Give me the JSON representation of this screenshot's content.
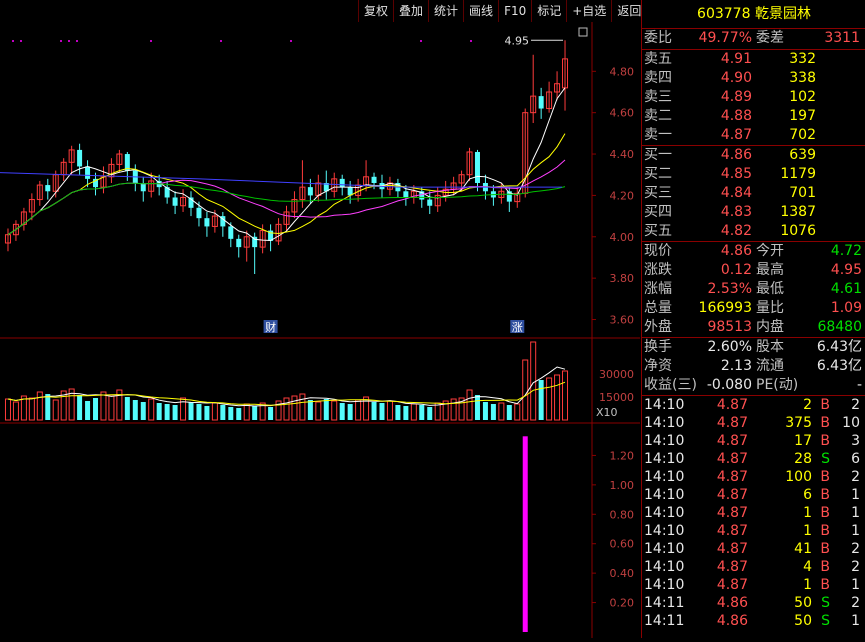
{
  "toolbar": [
    "复权",
    "叠加",
    "统计",
    "画线",
    "F10",
    "标记",
    "+自选",
    "返回"
  ],
  "stock": {
    "code": "603778",
    "name": "乾景园林"
  },
  "order_ratio": {
    "label1": "委比",
    "value1": "49.77%",
    "label2": "委差",
    "value2": "3311"
  },
  "asks": [
    {
      "label": "卖五",
      "price": "4.91",
      "vol": "332"
    },
    {
      "label": "卖四",
      "price": "4.90",
      "vol": "338"
    },
    {
      "label": "卖三",
      "price": "4.89",
      "vol": "102"
    },
    {
      "label": "卖二",
      "price": "4.88",
      "vol": "197"
    },
    {
      "label": "卖一",
      "price": "4.87",
      "vol": "702"
    }
  ],
  "bids": [
    {
      "label": "买一",
      "price": "4.86",
      "vol": "639"
    },
    {
      "label": "买二",
      "price": "4.85",
      "vol": "1179"
    },
    {
      "label": "买三",
      "price": "4.84",
      "vol": "701"
    },
    {
      "label": "买四",
      "price": "4.83",
      "vol": "1387"
    },
    {
      "label": "买五",
      "price": "4.82",
      "vol": "1076"
    }
  ],
  "quote": [
    {
      "l1": "现价",
      "v1": "4.86",
      "c1": "red",
      "l2": "今开",
      "v2": "4.72",
      "c2": "green"
    },
    {
      "l1": "涨跌",
      "v1": "0.12",
      "c1": "red",
      "l2": "最高",
      "v2": "4.95",
      "c2": "red"
    },
    {
      "l1": "涨幅",
      "v1": "2.53%",
      "c1": "red",
      "l2": "最低",
      "v2": "4.61",
      "c2": "green"
    },
    {
      "l1": "总量",
      "v1": "166993",
      "c1": "yellow",
      "l2": "量比",
      "v2": "1.09",
      "c2": "red"
    },
    {
      "l1": "外盘",
      "v1": "98513",
      "c1": "red",
      "l2": "内盘",
      "v2": "68480",
      "c2": "green"
    }
  ],
  "stats": [
    {
      "l1": "换手",
      "v1": "2.60%",
      "l2": "股本",
      "v2": "6.43亿"
    },
    {
      "l1": "净资",
      "v1": "2.13",
      "l2": "流通",
      "v2": "6.43亿"
    },
    {
      "l1": "收益(三)",
      "v1": "-0.080",
      "l2": "PE(动)",
      "v2": "-"
    }
  ],
  "ticks": [
    {
      "time": "14:10",
      "price": "4.87",
      "vol": "2",
      "side": "B",
      "n": "2"
    },
    {
      "time": "14:10",
      "price": "4.87",
      "vol": "375",
      "side": "B",
      "n": "10"
    },
    {
      "time": "14:10",
      "price": "4.87",
      "vol": "17",
      "side": "B",
      "n": "3"
    },
    {
      "time": "14:10",
      "price": "4.87",
      "vol": "28",
      "side": "S",
      "n": "6"
    },
    {
      "time": "14:10",
      "price": "4.87",
      "vol": "100",
      "side": "B",
      "n": "2"
    },
    {
      "time": "14:10",
      "price": "4.87",
      "vol": "6",
      "side": "B",
      "n": "1"
    },
    {
      "time": "14:10",
      "price": "4.87",
      "vol": "1",
      "side": "B",
      "n": "1"
    },
    {
      "time": "14:10",
      "price": "4.87",
      "vol": "1",
      "side": "B",
      "n": "1"
    },
    {
      "time": "14:10",
      "price": "4.87",
      "vol": "41",
      "side": "B",
      "n": "2"
    },
    {
      "time": "14:10",
      "price": "4.87",
      "vol": "4",
      "side": "B",
      "n": "2"
    },
    {
      "time": "14:10",
      "price": "4.87",
      "vol": "1",
      "side": "B",
      "n": "1"
    },
    {
      "time": "14:11",
      "price": "4.86",
      "vol": "50",
      "side": "S",
      "n": "2"
    },
    {
      "time": "14:11",
      "price": "4.86",
      "vol": "50",
      "side": "S",
      "n": "1"
    }
  ],
  "chart_data": {
    "type": "candlestick",
    "price_axis": [
      "4.80",
      "4.60",
      "4.40",
      "4.20",
      "4.00",
      "3.80",
      "3.60"
    ],
    "price_range": [
      3.53,
      4.99
    ],
    "high_label": "4.95",
    "markers": [
      "财",
      "涨"
    ],
    "volume_axis": [
      "30000",
      "15000"
    ],
    "volume_unit": "X10",
    "indicator_axis": [
      "1.20",
      "1.00",
      "0.80",
      "0.60",
      "0.40",
      "0.20"
    ],
    "candles": [
      [
        3.97,
        4.01,
        3.93,
        4.04
      ],
      [
        4.01,
        4.06,
        3.98,
        4.08
      ],
      [
        4.06,
        4.12,
        4.03,
        4.14
      ],
      [
        4.12,
        4.18,
        4.08,
        4.21
      ],
      [
        4.18,
        4.25,
        4.15,
        4.27
      ],
      [
        4.25,
        4.22,
        4.18,
        4.28
      ],
      [
        4.22,
        4.3,
        4.19,
        4.32
      ],
      [
        4.3,
        4.36,
        4.27,
        4.38
      ],
      [
        4.36,
        4.42,
        4.3,
        4.44
      ],
      [
        4.42,
        4.34,
        4.3,
        4.45
      ],
      [
        4.34,
        4.28,
        4.24,
        4.37
      ],
      [
        4.28,
        4.24,
        4.2,
        4.31
      ],
      [
        4.24,
        4.29,
        4.21,
        4.34
      ],
      [
        4.29,
        4.35,
        4.26,
        4.38
      ],
      [
        4.35,
        4.4,
        4.31,
        4.42
      ],
      [
        4.4,
        4.32,
        4.27,
        4.41
      ],
      [
        4.32,
        4.26,
        4.22,
        4.35
      ],
      [
        4.26,
        4.22,
        4.17,
        4.29
      ],
      [
        4.22,
        4.27,
        4.19,
        4.31
      ],
      [
        4.27,
        4.24,
        4.2,
        4.3
      ],
      [
        4.24,
        4.19,
        4.16,
        4.27
      ],
      [
        4.19,
        4.15,
        4.11,
        4.22
      ],
      [
        4.15,
        4.19,
        4.12,
        4.23
      ],
      [
        4.19,
        4.14,
        4.1,
        4.22
      ],
      [
        4.14,
        4.09,
        4.05,
        4.17
      ],
      [
        4.09,
        4.05,
        4.0,
        4.12
      ],
      [
        4.05,
        4.1,
        4.02,
        4.13
      ],
      [
        4.1,
        4.05,
        4.0,
        4.12
      ],
      [
        4.05,
        3.99,
        3.95,
        4.07
      ],
      [
        3.99,
        3.95,
        3.9,
        4.01
      ],
      [
        3.95,
        4.0,
        3.88,
        4.03
      ],
      [
        4.0,
        3.95,
        3.82,
        4.02
      ],
      [
        3.95,
        4.03,
        3.92,
        4.06
      ],
      [
        4.03,
        3.98,
        3.93,
        4.06
      ],
      [
        3.98,
        4.06,
        3.96,
        4.09
      ],
      [
        4.06,
        4.12,
        4.03,
        4.15
      ],
      [
        4.12,
        4.18,
        4.09,
        4.22
      ],
      [
        4.18,
        4.24,
        4.14,
        4.37
      ],
      [
        4.24,
        4.2,
        4.16,
        4.28
      ],
      [
        4.2,
        4.26,
        4.17,
        4.3
      ],
      [
        4.26,
        4.22,
        4.18,
        4.32
      ],
      [
        4.22,
        4.28,
        4.19,
        4.31
      ],
      [
        4.28,
        4.24,
        4.2,
        4.3
      ],
      [
        4.24,
        4.2,
        4.16,
        4.27
      ],
      [
        4.2,
        4.25,
        4.17,
        4.28
      ],
      [
        4.25,
        4.29,
        4.22,
        4.37
      ],
      [
        4.29,
        4.26,
        4.23,
        4.31
      ],
      [
        4.26,
        4.23,
        4.19,
        4.3
      ],
      [
        4.23,
        4.26,
        4.2,
        4.29
      ],
      [
        4.26,
        4.22,
        4.19,
        4.28
      ],
      [
        4.22,
        4.19,
        4.15,
        4.25
      ],
      [
        4.19,
        4.22,
        4.16,
        4.25
      ],
      [
        4.22,
        4.18,
        4.14,
        4.24
      ],
      [
        4.18,
        4.15,
        4.11,
        4.22
      ],
      [
        4.15,
        4.2,
        4.12,
        4.24
      ],
      [
        4.2,
        4.23,
        4.17,
        4.27
      ],
      [
        4.23,
        4.26,
        4.2,
        4.29
      ],
      [
        4.26,
        4.3,
        4.22,
        4.32
      ],
      [
        4.3,
        4.41,
        4.27,
        4.43
      ],
      [
        4.41,
        4.26,
        4.22,
        4.42
      ],
      [
        4.26,
        4.22,
        4.18,
        4.3
      ],
      [
        4.22,
        4.19,
        4.15,
        4.25
      ],
      [
        4.19,
        4.22,
        4.16,
        4.26
      ],
      [
        4.22,
        4.17,
        4.12,
        4.24
      ],
      [
        4.17,
        4.21,
        4.14,
        4.24
      ],
      [
        4.21,
        4.6,
        4.19,
        4.62
      ],
      [
        4.6,
        4.68,
        4.55,
        4.88
      ],
      [
        4.68,
        4.62,
        4.57,
        4.72
      ],
      [
        4.62,
        4.7,
        4.6,
        4.75
      ],
      [
        4.7,
        4.74,
        4.66,
        4.8
      ],
      [
        4.72,
        4.86,
        4.61,
        4.95
      ]
    ],
    "volumes": [
      21,
      18,
      24,
      22,
      28,
      26,
      20,
      29,
      31,
      25,
      19,
      22,
      28,
      24,
      30,
      23,
      20,
      18,
      21,
      17,
      16,
      15,
      22,
      18,
      16,
      14,
      17,
      15,
      13,
      12,
      16,
      14,
      17,
      13,
      19,
      22,
      24,
      26,
      20,
      18,
      21,
      19,
      17,
      16,
      20,
      23,
      18,
      17,
      19,
      15,
      14,
      16,
      15,
      13,
      17,
      19,
      21,
      22,
      30,
      25,
      18,
      16,
      17,
      15,
      16,
      60,
      78,
      40,
      42,
      45,
      49
    ],
    "indicator_spike": {
      "index": 65,
      "value": 1.33
    }
  }
}
